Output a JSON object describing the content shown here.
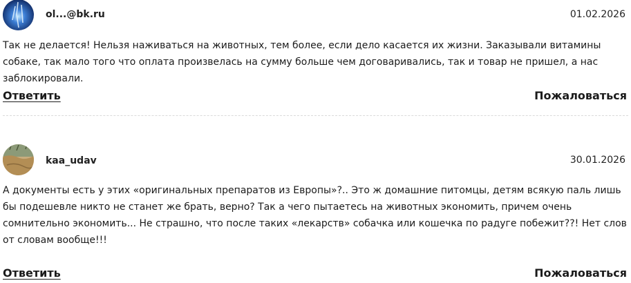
{
  "comments": [
    {
      "username": "ol...@bk.ru",
      "date": "01.02.2026",
      "text": "Так не делается! Нельзя наживаться на животных, тем более, если дело касается их жизни. Заказывали витамины собаке, так мало того что оплата произвелась на сумму больше чем договаривались, так и товар не пришел, а нас заблокировали.",
      "reply_label": "Ответить",
      "report_label": "Пожаловаться",
      "avatar_colors": {
        "background": "#0b2c6e",
        "accent": "#7fc3ff"
      }
    },
    {
      "username": "kaa_udav",
      "date": "30.01.2026",
      "text": "А документы есть у этих «оригинальных препаратов из Европы»?.. Это ж домашние питомцы, детям всякую паль лишь бы подешевле никто не станет же брать, верно? Так а чего пытаетесь на животных экономить, причем очень сомнительно экономить... Не страшно, что после таких «лекарств» собачка или кошечка по радуге побежит??! Нет слов от словам вообще!!!",
      "reply_label": "Ответить",
      "report_label": "Пожаловаться",
      "avatar_colors": {
        "background": "#b89a6a",
        "accent": "#6e7b5a"
      }
    }
  ]
}
